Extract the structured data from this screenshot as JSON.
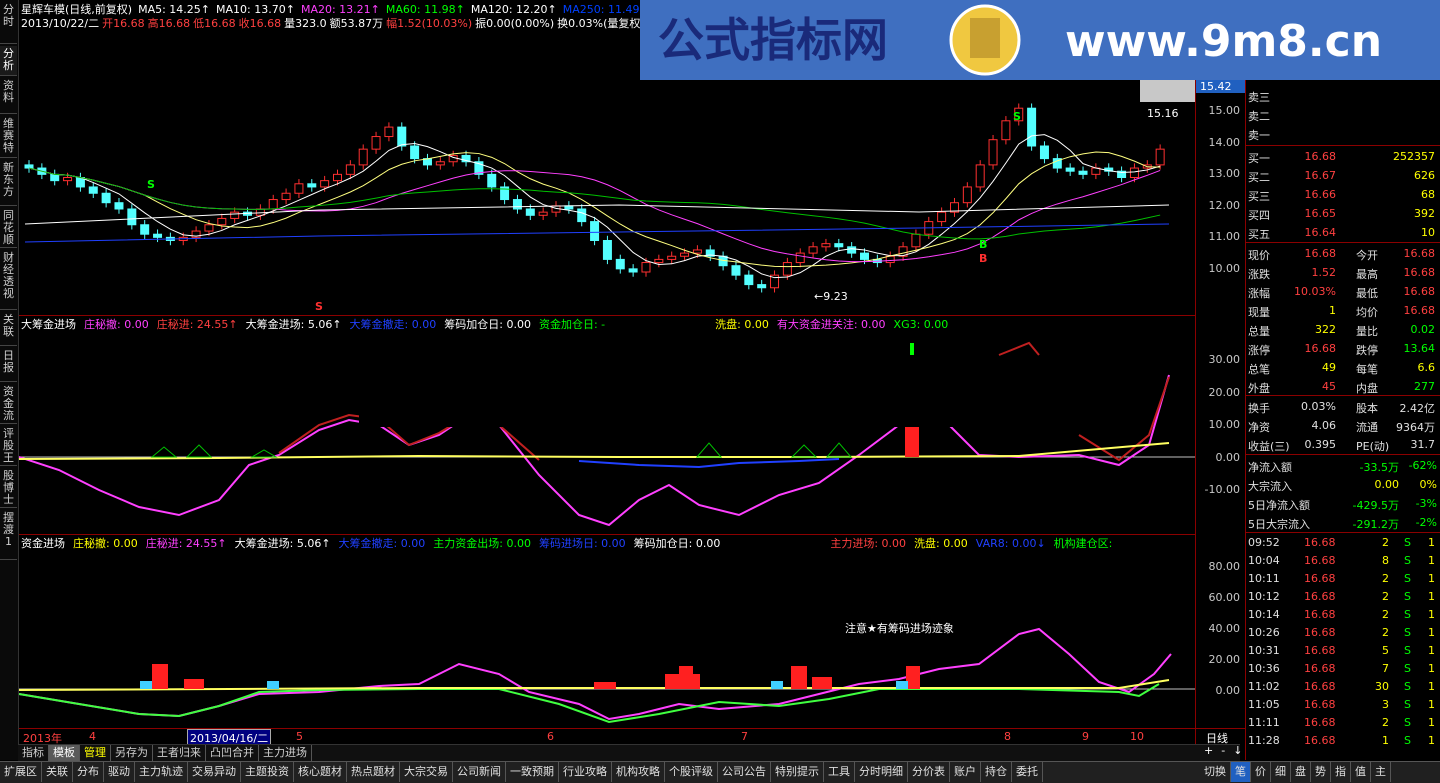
{
  "left_tabs": [
    "分时",
    "分析",
    "资料",
    "维赛特",
    "新东方",
    "同花顺",
    "财经透视",
    "关联",
    "日报",
    "资金流",
    "评股王",
    "股博士",
    "摆渡1"
  ],
  "banner": {
    "brand": "公式指标网",
    "url": "www.9m8.cn",
    "seal": "9m8.cn"
  },
  "k_panel": {
    "title": "星辉车模(日线,前复权)",
    "ma": [
      {
        "label": "MA5: 14.25↑",
        "color": "#ffffff"
      },
      {
        "label": "MA10: 13.70↑",
        "color": "#ffffff"
      },
      {
        "label": "MA20: 13.21↑",
        "color": "#ff40ff"
      },
      {
        "label": "MA60: 11.98↑",
        "color": "#00ff00"
      },
      {
        "label": "MA120: 12.20↑",
        "color": "#ffffff"
      },
      {
        "label": "MA250: 11.49↑",
        "color": "#0040ff"
      }
    ],
    "info_line": [
      {
        "t": "2013/10/22/二",
        "c": "#ffffff"
      },
      {
        "t": "开16.68",
        "c": "#ff4040"
      },
      {
        "t": "高16.68",
        "c": "#ff4040"
      },
      {
        "t": "低16.68",
        "c": "#ff4040"
      },
      {
        "t": "收16.68",
        "c": "#ff4040"
      },
      {
        "t": "量323.0",
        "c": "#ffffff"
      },
      {
        "t": "额53.87万",
        "c": "#ffffff"
      },
      {
        "t": "幅1.52(10.03%)",
        "c": "#ff4040"
      },
      {
        "t": "振0.00(0.00%)",
        "c": "#ffffff"
      },
      {
        "t": "换0.03%(量复权)",
        "c": "#ffffff"
      }
    ],
    "y_ticks": [
      "15.00",
      "14.00",
      "13.00",
      "12.00",
      "11.00",
      "10.00"
    ],
    "price_tag": "15.42",
    "high_label": "15.16",
    "low_label": "9.23",
    "signals": [
      "S",
      "S",
      "S",
      "B",
      "B"
    ]
  },
  "mid_panel": {
    "labels": [
      {
        "t": "大筹金进场",
        "c": "#ffffff"
      },
      {
        "t": "庄秘撤: 0.00",
        "c": "#ff40ff"
      },
      {
        "t": "庄秘进: 24.55↑",
        "c": "#ff4040"
      },
      {
        "t": "大筹金进场: 5.06↑",
        "c": "#ffffff"
      },
      {
        "t": "大筹金撤走: 0.00",
        "c": "#2040ff"
      },
      {
        "t": "筹码加仓日: 0.00",
        "c": "#ffffff"
      },
      {
        "t": "资金加仓日: -",
        "c": "#00ff00"
      },
      {
        "t": "洗盘: 0.00",
        "c": "#ffff00"
      },
      {
        "t": "有大资金进关注: 0.00",
        "c": "#ff40ff"
      },
      {
        "t": "XG3: 0.00",
        "c": "#00ff00"
      }
    ],
    "y_ticks": [
      "30.00",
      "20.00",
      "10.00",
      "0.00",
      "-10.00"
    ]
  },
  "low_panel": {
    "labels": [
      {
        "t": "资金进场",
        "c": "#ffffff"
      },
      {
        "t": "庄秘撤: 0.00",
        "c": "#ffff00"
      },
      {
        "t": "庄秘进: 24.55↑",
        "c": "#ff40ff"
      },
      {
        "t": "大筹金进场: 5.06↑",
        "c": "#ffffff"
      },
      {
        "t": "大筹金撤走: 0.00",
        "c": "#2040ff"
      },
      {
        "t": "主力资金出场: 0.00",
        "c": "#00ff00"
      },
      {
        "t": "筹码进场日: 0.00",
        "c": "#2040ff"
      },
      {
        "t": "筹码加仓日: 0.00",
        "c": "#ffffff"
      },
      {
        "t": "主力进场: 0.00",
        "c": "#ff4040"
      },
      {
        "t": "洗盘: 0.00",
        "c": "#ffff00"
      },
      {
        "t": "VAR8: 0.00↓",
        "c": "#2040ff"
      },
      {
        "t": "机构建仓区:",
        "c": "#00ff00"
      }
    ],
    "note": "注意★有筹码进场迹象",
    "y_ticks": [
      "80.00",
      "60.00",
      "40.00",
      "20.00",
      "0.00"
    ]
  },
  "date_axis": {
    "year": "2013年",
    "months": [
      "4",
      "5",
      "6",
      "7",
      "8",
      "9",
      "10"
    ],
    "cursor_date": "2013/04/16/二",
    "period": "日线"
  },
  "quote": {
    "sells": [
      "卖三",
      "卖二",
      "卖一"
    ],
    "buys": [
      {
        "name": "买一",
        "price": "16.68",
        "vol": "252357"
      },
      {
        "name": "买二",
        "price": "16.67",
        "vol": "626"
      },
      {
        "name": "买三",
        "price": "16.66",
        "vol": "68"
      },
      {
        "name": "买四",
        "price": "16.65",
        "vol": "392"
      },
      {
        "name": "买五",
        "price": "16.64",
        "vol": "10"
      }
    ],
    "stats": [
      {
        "a": "现价",
        "av": "16.68",
        "ac": "#ff4040",
        "b": "今开",
        "bv": "16.68",
        "bc": "#ff4040"
      },
      {
        "a": "涨跌",
        "av": "1.52",
        "ac": "#ff4040",
        "b": "最高",
        "bv": "16.68",
        "bc": "#ff4040"
      },
      {
        "a": "涨幅",
        "av": "10.03%",
        "ac": "#ff4040",
        "b": "最低",
        "bv": "16.68",
        "bc": "#ff4040"
      },
      {
        "a": "现量",
        "av": "1",
        "ac": "#ffff00",
        "b": "均价",
        "bv": "16.68",
        "bc": "#ff4040"
      },
      {
        "a": "总量",
        "av": "322",
        "ac": "#ffff00",
        "b": "量比",
        "bv": "0.02",
        "bc": "#00ff00"
      },
      {
        "a": "涨停",
        "av": "16.68",
        "ac": "#ff4040",
        "b": "跌停",
        "bv": "13.64",
        "bc": "#00ff00"
      },
      {
        "a": "总笔",
        "av": "49",
        "ac": "#ffff00",
        "b": "每笔",
        "bv": "6.6",
        "bc": "#ffff00"
      },
      {
        "a": "外盘",
        "av": "45",
        "ac": "#ff4040",
        "b": "内盘",
        "bv": "277",
        "bc": "#00ff00"
      }
    ],
    "stats2": [
      {
        "a": "换手",
        "av": "0.03%",
        "b": "股本",
        "bv": "2.42亿"
      },
      {
        "a": "净资",
        "av": "4.06",
        "b": "流通",
        "bv": "9364万"
      },
      {
        "a": "收益(三)",
        "av": "0.395",
        "b": "PE(动)",
        "bv": "31.7"
      }
    ],
    "flows": [
      {
        "a": "净流入额",
        "v": "-33.5万",
        "p": "-62%"
      },
      {
        "a": "大宗流入",
        "v": "0.00",
        "p": "0%"
      },
      {
        "a": "5日净流入额",
        "v": "-429.5万",
        "p": "-3%"
      },
      {
        "a": "5日大宗流入",
        "v": "-291.2万",
        "p": "-2%"
      }
    ],
    "ticks": [
      {
        "t": "09:52",
        "p": "16.68",
        "v": "2",
        "s": "S",
        "n": "1"
      },
      {
        "t": "10:04",
        "p": "16.68",
        "v": "8",
        "s": "S",
        "n": "1"
      },
      {
        "t": "10:11",
        "p": "16.68",
        "v": "2",
        "s": "S",
        "n": "1"
      },
      {
        "t": "10:12",
        "p": "16.68",
        "v": "2",
        "s": "S",
        "n": "1"
      },
      {
        "t": "10:14",
        "p": "16.68",
        "v": "2",
        "s": "S",
        "n": "1"
      },
      {
        "t": "10:26",
        "p": "16.68",
        "v": "2",
        "s": "S",
        "n": "1"
      },
      {
        "t": "10:31",
        "p": "16.68",
        "v": "5",
        "s": "S",
        "n": "1"
      },
      {
        "t": "10:36",
        "p": "16.68",
        "v": "7",
        "s": "S",
        "n": "1"
      },
      {
        "t": "11:02",
        "p": "16.68",
        "v": "30",
        "s": "S",
        "n": "1"
      },
      {
        "t": "11:05",
        "p": "16.68",
        "v": "3",
        "s": "S",
        "n": "1"
      },
      {
        "t": "11:11",
        "p": "16.68",
        "v": "2",
        "s": "S",
        "n": "1"
      },
      {
        "t": "11:28",
        "p": "16.68",
        "v": "1",
        "s": "S",
        "n": "1"
      }
    ]
  },
  "indicator_tabs": [
    "指标",
    "模板",
    "管理",
    "另存为",
    "王者归来",
    "凸凹合并",
    "主力进场"
  ],
  "nav_controls": [
    "+",
    "-",
    "↓"
  ],
  "menu": [
    "扩展区",
    "关联",
    "分布",
    "驱动",
    "主力轨迹",
    "交易异动",
    "主题投资",
    "核心题材",
    "热点题材",
    "大宗交易",
    "公司新闻",
    "一致预期",
    "行业攻略",
    "机构攻略",
    "个股评级",
    "公司公告",
    "特别提示",
    "工具",
    "分时明细",
    "分价表",
    "账户",
    "持仓",
    "委托"
  ],
  "menu_right": [
    "切换",
    "笔",
    "价",
    "细",
    "盘",
    "势",
    "指",
    "值",
    "主"
  ]
}
